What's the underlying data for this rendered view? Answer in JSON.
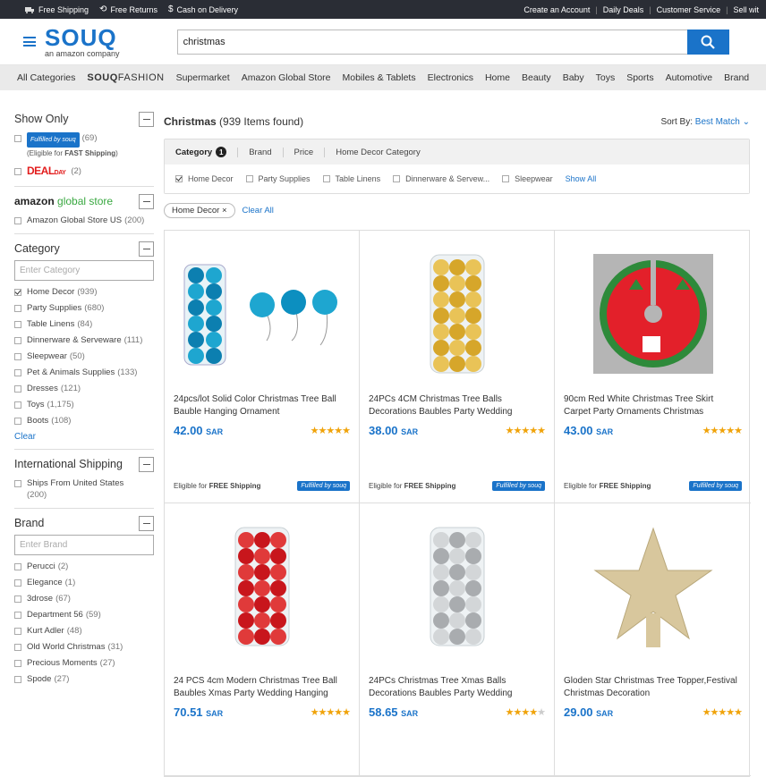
{
  "topbar": {
    "free_shipping": "Free Shipping",
    "free_returns": "Free Returns",
    "cash_on_delivery": "Cash on Delivery",
    "create_account": "Create an Account",
    "daily_deals": "Daily Deals",
    "customer_service": "Customer Service",
    "sell_with": "Sell wit"
  },
  "logo": {
    "name": "SOUQ",
    "tagline": "an amazon company"
  },
  "search": {
    "value": "christmas"
  },
  "nav": {
    "all_categories": "All Categories",
    "souq": "SOUQ",
    "fashion": "FASHION",
    "items": [
      "Supermarket",
      "Amazon Global Store",
      "Mobiles & Tablets",
      "Electronics",
      "Home",
      "Beauty",
      "Baby",
      "Toys",
      "Sports",
      "Automotive",
      "Brand"
    ]
  },
  "sidebar": {
    "show_only": {
      "title": "Show Only",
      "fulfilled_label": "Fulfilled by souq",
      "fulfilled_count": "(69)",
      "fulfilled_note_pre": "(Eligible for ",
      "fulfilled_note_bold": "FAST Shipping",
      "fulfilled_note_post": ")",
      "deal_label": "DEAL",
      "deal_day": "DAY",
      "deal_count": "(2)"
    },
    "amazon_global": {
      "logo_a": "amazon",
      "logo_b": "global store",
      "item": "Amazon Global Store US",
      "count": "(200)"
    },
    "category": {
      "title": "Category",
      "placeholder": "Enter Category",
      "items": [
        {
          "label": "Home Decor",
          "count": "(939)",
          "checked": true
        },
        {
          "label": "Party Supplies",
          "count": "(680)",
          "checked": false
        },
        {
          "label": "Table Linens",
          "count": "(84)",
          "checked": false
        },
        {
          "label": "Dinnerware & Serveware",
          "count": "(111)",
          "checked": false
        },
        {
          "label": "Sleepwear",
          "count": "(50)",
          "checked": false
        },
        {
          "label": "Pet & Animals Supplies",
          "count": "(133)",
          "checked": false
        },
        {
          "label": "Dresses",
          "count": "(121)",
          "checked": false
        },
        {
          "label": "Toys",
          "count": "(1,175)",
          "checked": false
        },
        {
          "label": "Boots",
          "count": "(108)",
          "checked": false
        }
      ],
      "clear": "Clear"
    },
    "intl_shipping": {
      "title": "International Shipping",
      "item": "Ships From United States",
      "count": "(200)"
    },
    "brand": {
      "title": "Brand",
      "placeholder": "Enter Brand",
      "items": [
        {
          "label": "Perucci",
          "count": "(2)"
        },
        {
          "label": "Elegance",
          "count": "(1)"
        },
        {
          "label": "3drose",
          "count": "(67)"
        },
        {
          "label": "Department 56",
          "count": "(59)"
        },
        {
          "label": "Kurt Adler",
          "count": "(48)"
        },
        {
          "label": "Old World Christmas",
          "count": "(31)"
        },
        {
          "label": "Precious Moments",
          "count": "(27)"
        },
        {
          "label": "Spode",
          "count": "(27)"
        }
      ]
    }
  },
  "results": {
    "title": "Christmas",
    "found": "(939 Items found)",
    "sort_label": "Sort By:",
    "sort_value": "Best Match",
    "tabs": [
      "Category",
      "Brand",
      "Price",
      "Home Decor Category"
    ],
    "tab_badge": "1",
    "options": [
      {
        "label": "Home Decor",
        "checked": true
      },
      {
        "label": "Party Supplies",
        "checked": false
      },
      {
        "label": "Table Linens",
        "checked": false
      },
      {
        "label": "Dinnerware & Servew...",
        "checked": false
      },
      {
        "label": "Sleepwear",
        "checked": false
      }
    ],
    "show_all": "Show All",
    "chip": "Home Decor",
    "chip_x": "×",
    "clear_all": "Clear All"
  },
  "products": [
    {
      "title": "24pcs/lot Solid Color Christmas Tree Ball Bauble Hanging Ornament",
      "price": "42.00",
      "currency": "SAR",
      "rating": 4.5,
      "ship_pre": "Eligible for ",
      "ship_bold": "FREE Shipping",
      "badge": "Fulfilled by souq",
      "img": "blue"
    },
    {
      "title": "24PCs 4CM Christmas Tree Balls Decorations Baubles Party Wedding",
      "price": "38.00",
      "currency": "SAR",
      "rating": 4.5,
      "ship_pre": "Eligible for ",
      "ship_bold": "FREE Shipping",
      "badge": "Fulfilled by souq",
      "img": "gold"
    },
    {
      "title": "90cm Red White Christmas Tree Skirt Carpet Party Ornaments Christmas",
      "price": "43.00",
      "currency": "SAR",
      "rating": 5,
      "ship_pre": "Eligible for ",
      "ship_bold": "FREE Shipping",
      "badge": "Fulfilled by souq",
      "img": "skirt"
    },
    {
      "title": "24 PCS 4cm Modern Christmas Tree Ball Baubles Xmas Party Wedding Hanging",
      "price": "70.51",
      "currency": "SAR",
      "rating": 5,
      "img": "red"
    },
    {
      "title": "24PCs Christmas Tree Xmas Balls Decorations Baubles Party Wedding",
      "price": "58.65",
      "currency": "SAR",
      "rating": 4,
      "img": "silver"
    },
    {
      "title": "Gloden Star Christmas Tree Topper,Festival Christmas Decoration",
      "price": "29.00",
      "currency": "SAR",
      "rating": 5,
      "img": "star"
    }
  ]
}
